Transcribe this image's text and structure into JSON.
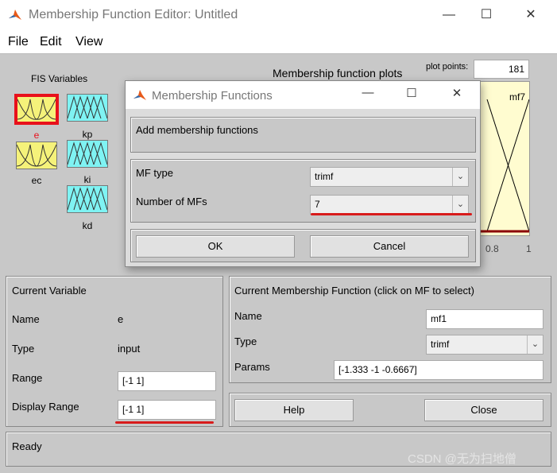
{
  "window": {
    "title": "Membership Function Editor: Untitled",
    "minimize": "—",
    "maximize": "☐",
    "close": "✕"
  },
  "menu": {
    "file": "File",
    "edit": "Edit",
    "view": "View"
  },
  "fis": {
    "heading": "FIS Variables",
    "inputs": [
      {
        "label": "e"
      },
      {
        "label": "ec"
      }
    ],
    "outputs": [
      {
        "label": "kp"
      },
      {
        "label": "ki"
      },
      {
        "label": "kd"
      }
    ]
  },
  "plot": {
    "title": "Membership function plots",
    "points_label": "plot points:",
    "points_value": "181",
    "mf_label": "mf7",
    "tick_08": "0.8",
    "tick_1": "1"
  },
  "dialog": {
    "title": "Membership Functions",
    "heading": "Add membership functions",
    "mf_type_label": "MF type",
    "mf_type_value": "trimf",
    "num_label": "Number of MFs",
    "num_value": "7",
    "ok": "OK",
    "cancel": "Cancel"
  },
  "current_variable": {
    "heading": "Current Variable",
    "name_label": "Name",
    "name_value": "e",
    "type_label": "Type",
    "type_value": "input",
    "range_label": "Range",
    "range_value": "[-1 1]",
    "display_range_label": "Display Range",
    "display_range_value": "[-1 1]"
  },
  "current_mf": {
    "heading": "Current Membership Function (click on MF to select)",
    "name_label": "Name",
    "name_value": "mf1",
    "type_label": "Type",
    "type_value": "trimf",
    "params_label": "Params",
    "params_value": "[-1.333 -1 -0.6667]"
  },
  "buttons": {
    "help": "Help",
    "close": "Close"
  },
  "status": "Ready",
  "watermark": "CSDN @无为扫地僧",
  "colors": {
    "selected_border": "#e8101b",
    "input_var": "#f5f27a",
    "output_var": "#7ff3f3",
    "annotation": "#d81b1b",
    "plot_bg": "#fffcd0"
  }
}
